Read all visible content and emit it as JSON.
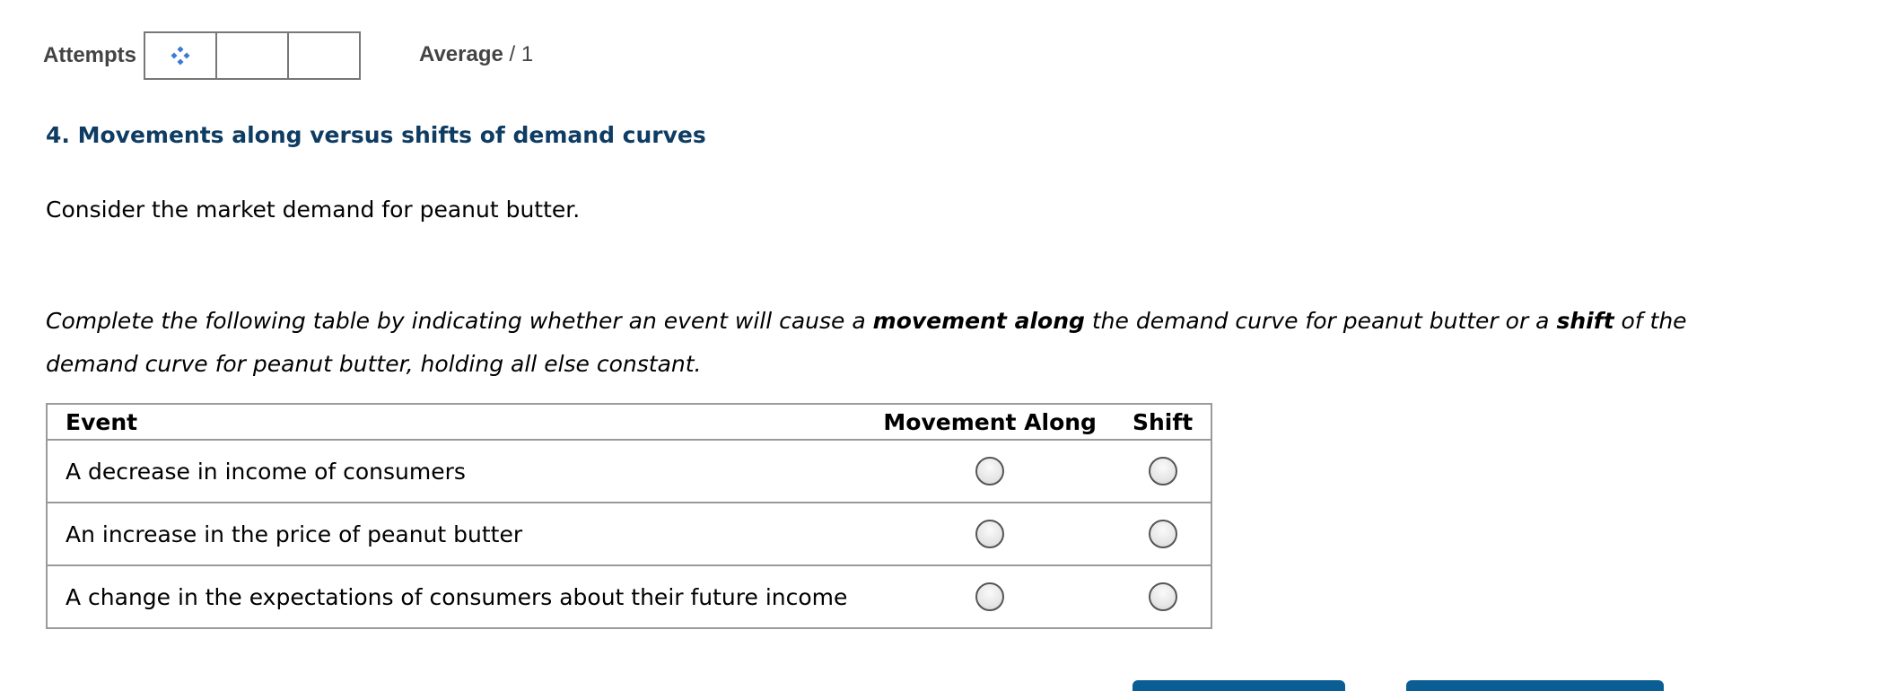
{
  "attempts": {
    "label": "Attempts",
    "loading_icon": "loading-dots-icon"
  },
  "average": {
    "label": "Average",
    "value": "/ 1"
  },
  "question": {
    "title": "4. Movements along versus shifts of demand curves",
    "intro": "Consider the market demand for peanut butter.",
    "instructions": {
      "part1": "Complete the following table by indicating whether an event will cause a ",
      "bold1": "movement along",
      "part2": " the demand curve for peanut butter or a ",
      "bold2": "shift",
      "part3": " of the demand curve for peanut butter, holding all else constant."
    }
  },
  "table": {
    "headers": {
      "event": "Event",
      "movement": "Movement Along",
      "shift": "Shift"
    },
    "rows": [
      {
        "event": "A decrease in income of consumers"
      },
      {
        "event": "An increase in the price of peanut butter"
      },
      {
        "event": "A change in the expectations of consumers about their future income"
      }
    ]
  },
  "colors": {
    "title": "#0e3c63",
    "button": "#0b5e94",
    "loading_icon": "#3b7bd4"
  }
}
